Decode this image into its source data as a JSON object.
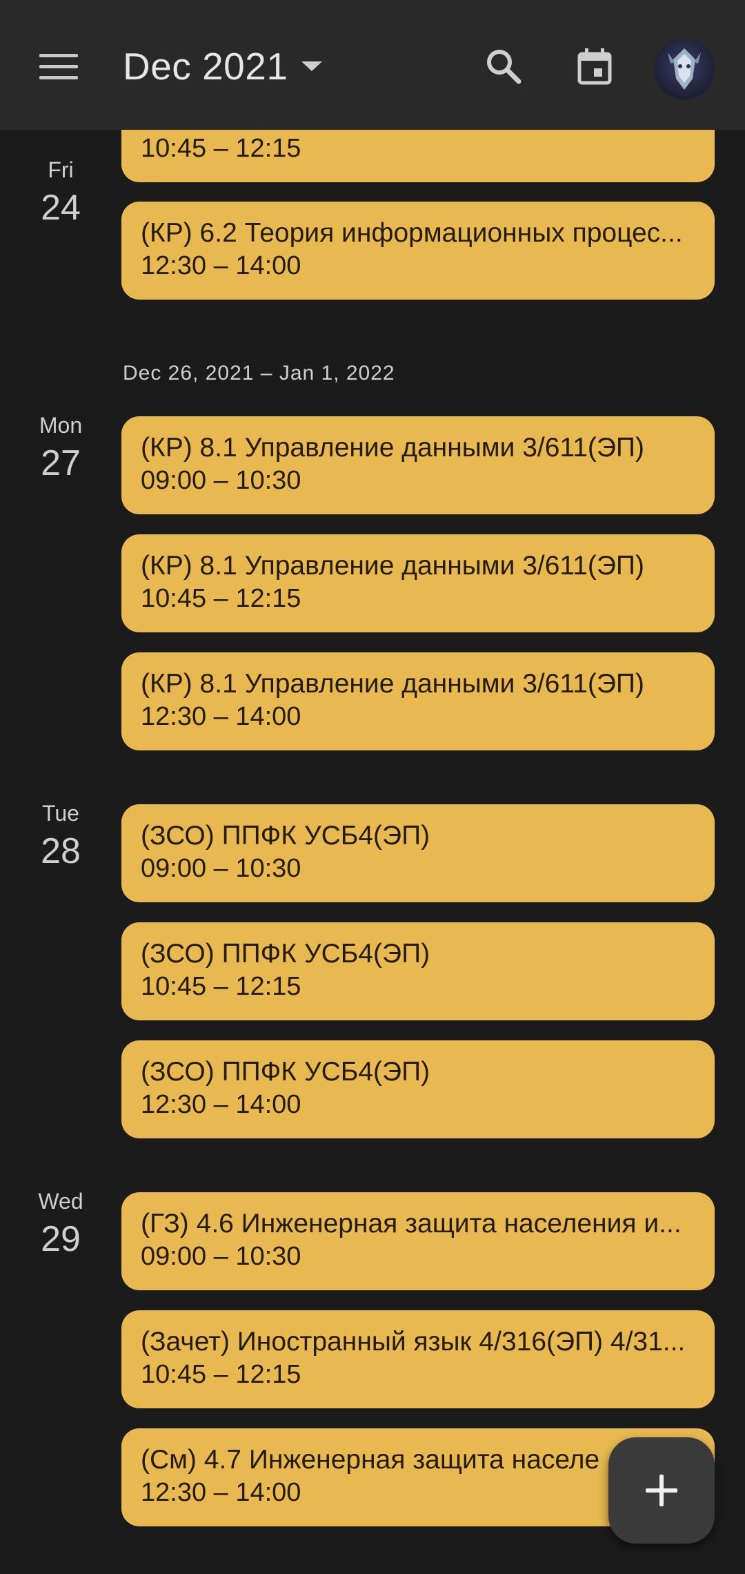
{
  "header": {
    "title": "Dec 2021",
    "menu_icon": "menu-icon",
    "search_icon": "search-icon",
    "today_icon": "calendar-today-icon",
    "avatar": "account-avatar"
  },
  "week_range": "Dec 26, 2021 – Jan 1, 2022",
  "days": [
    {
      "dow": "Fri",
      "num": "24"
    },
    {
      "dow": "Mon",
      "num": "27"
    },
    {
      "dow": "Tue",
      "num": "28"
    },
    {
      "dow": "Wed",
      "num": "29"
    }
  ],
  "events": [
    {
      "title": "",
      "time": "10:45 – 12:15"
    },
    {
      "title": "(КР) 6.2 Теория информационных процес...",
      "time": "12:30 – 14:00"
    },
    {
      "title": "(КР) 8.1 Управление данными 3/611(ЭП)",
      "time": "09:00 – 10:30"
    },
    {
      "title": "(КР) 8.1 Управление данными 3/611(ЭП)",
      "time": "10:45 – 12:15"
    },
    {
      "title": "(КР) 8.1 Управление данными 3/611(ЭП)",
      "time": "12:30 – 14:00"
    },
    {
      "title": "(ЗСО) ППФК УСБ4(ЭП)",
      "time": "09:00 – 10:30"
    },
    {
      "title": "(ЗСО) ППФК УСБ4(ЭП)",
      "time": "10:45 – 12:15"
    },
    {
      "title": "(ЗСО) ППФК УСБ4(ЭП)",
      "time": "12:30 – 14:00"
    },
    {
      "title": "(ГЗ) 4.6 Инженерная защита населения и...",
      "time": "09:00 – 10:30"
    },
    {
      "title": "(Зачет) Иностранный язык 4/316(ЭП) 4/31...",
      "time": "10:45 – 12:15"
    },
    {
      "title": "(См) 4.7 Инженерная защита населе",
      "time": "12:30 – 14:00"
    }
  ],
  "fab": {
    "icon": "plus-icon"
  },
  "colors": {
    "event": "#e8b950",
    "background": "#1b1b1c",
    "appbar": "#292929"
  }
}
